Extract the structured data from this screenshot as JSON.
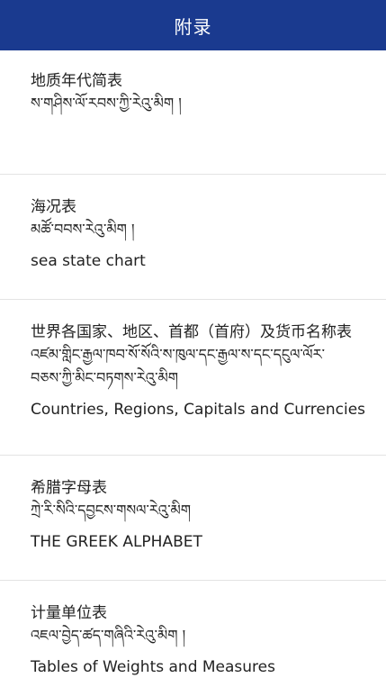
{
  "header": {
    "title": "附录"
  },
  "items": [
    {
      "zh": "地质年代简表",
      "bo": "ས་གཤིས་ལོ་རབས་ཀྱི་རེའུ་མིག །",
      "en": ""
    },
    {
      "zh": "海况表",
      "bo": "མཚོ་བབས་རེའུ་མིག །",
      "en": "sea state chart"
    },
    {
      "zh": "世界各国家、地区、首都（首府）及货币名称表",
      "bo": "འཛམ་གླིང་རྒྱལ་ཁབ་སོ་སོའི་ས་ཁུལ་དང་རྒྱལ་ས་དང་དངུལ་ལོར་བཅས་ཀྱི་མིང་བཏགས་རེའུ་མིག",
      "en": "Countries, Regions, Capitals and Currencies"
    },
    {
      "zh": "希腊字母表",
      "bo": "ཀྲེ་རི་སིའི་དབྱངས་གསལ་རེའུ་མིག",
      "en": "THE GREEK ALPHABET"
    },
    {
      "zh": "计量单位表",
      "bo": "འཇལ་བྱེད་ཚད་གཞིའི་རེའུ་མིག །",
      "en": "Tables of Weights and Measures"
    }
  ]
}
